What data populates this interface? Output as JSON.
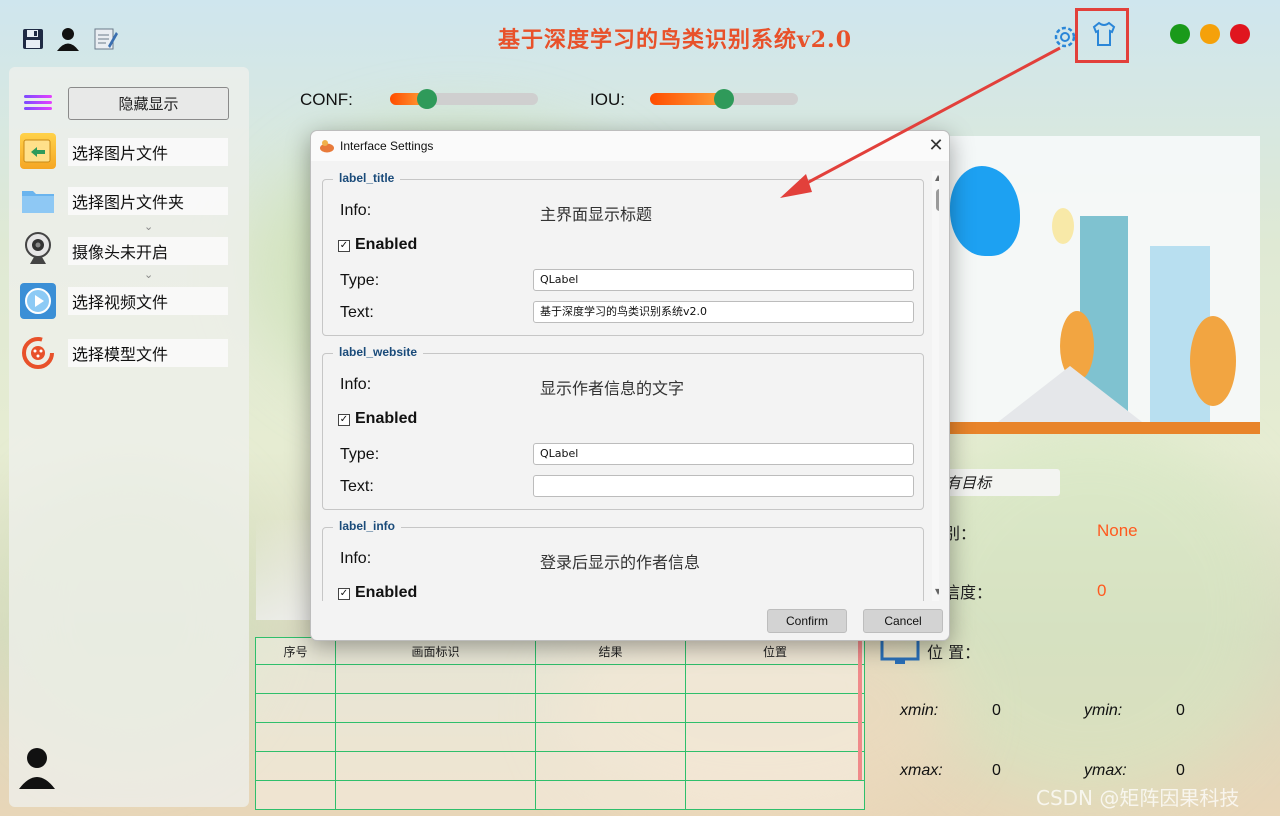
{
  "app": {
    "title": "基于深度学习的鸟类识别系统v2.0",
    "colors": {
      "title": "#e8512a",
      "accent_red": "#e2403b",
      "win_green": "#1a9a1a",
      "win_yellow": "#f5a10a",
      "win_red": "#e0151e"
    }
  },
  "toolbar": {
    "icons": [
      "save-icon",
      "user-icon",
      "edit-icon",
      "settings-icon",
      "skin-icon"
    ]
  },
  "sidebar": {
    "toggle_label": "隐藏显示",
    "items": [
      {
        "label": "选择图片文件",
        "icon": "image-file-icon"
      },
      {
        "label": "选择图片文件夹",
        "icon": "folder-icon"
      },
      {
        "label": "摄像头未开启",
        "icon": "webcam-icon"
      },
      {
        "label": "选择视频文件",
        "icon": "video-file-icon"
      },
      {
        "label": "选择模型文件",
        "icon": "model-file-icon"
      }
    ]
  },
  "sliders": {
    "conf": {
      "label": "CONF:",
      "value": 0.25
    },
    "iou": {
      "label": "IOU:",
      "value": 0.5
    }
  },
  "results_panel": {
    "target_select": "有目标",
    "class_label": "别：",
    "class_value": "None",
    "conf_label": "信度：",
    "conf_value": "0",
    "position_label": "位 置：",
    "xmin_label": "xmin:",
    "xmin": "0",
    "ymin_label": "ymin:",
    "ymin": "0",
    "xmax_label": "xmax:",
    "xmax": "0",
    "ymax_label": "ymax:",
    "ymax": "0"
  },
  "table": {
    "headers": [
      "序号",
      "画面标识",
      "结果",
      "位置"
    ]
  },
  "dialog": {
    "title": "Interface Settings",
    "confirm": "Confirm",
    "cancel": "Cancel",
    "labels": {
      "info": "Info:",
      "enabled": "Enabled",
      "type": "Type:",
      "text": "Text:"
    },
    "groups": [
      {
        "name": "label_title",
        "info": "主界面显示标题",
        "enabled": true,
        "type": "QLabel",
        "text": "基于深度学习的鸟类识别系统v2.0"
      },
      {
        "name": "label_website",
        "info": "显示作者信息的文字",
        "enabled": true,
        "type": "QLabel",
        "text": ""
      },
      {
        "name": "label_info",
        "info": "登录后显示的作者信息",
        "enabled": true,
        "type": "",
        "text": ""
      }
    ]
  },
  "watermark": "CSDN @矩阵因果科技"
}
